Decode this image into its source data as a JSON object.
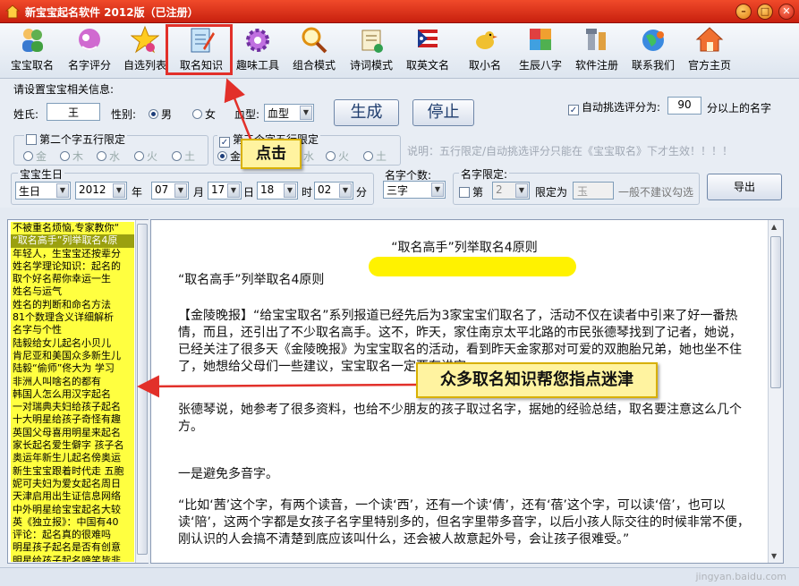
{
  "window": {
    "title": "新宝宝起名软件 2012版（已注册）",
    "min": "–",
    "max": "□",
    "close": "✕"
  },
  "toolbar": [
    {
      "label": "宝宝取名",
      "icon": "people-icon"
    },
    {
      "label": "名字评分",
      "icon": "score-icon"
    },
    {
      "label": "自选列表",
      "icon": "star-icon"
    },
    {
      "label": "取名知识",
      "icon": "notebook-pencil-icon"
    },
    {
      "label": "趣味工具",
      "icon": "gear-icon"
    },
    {
      "label": "组合模式",
      "icon": "magnifier-icon"
    },
    {
      "label": "诗词模式",
      "icon": "scroll-icon"
    },
    {
      "label": "取英文名",
      "icon": "flag-icon"
    },
    {
      "label": "取小名",
      "icon": "bird-icon"
    },
    {
      "label": "生辰八字",
      "icon": "blocks-icon"
    },
    {
      "label": "软件注册",
      "icon": "tools-icon"
    },
    {
      "label": "联系我们",
      "icon": "globe-icon"
    },
    {
      "label": "官方主页",
      "icon": "home-icon"
    }
  ],
  "settings": {
    "heading": "请设置宝宝相关信息:",
    "surname_label": "姓氏:",
    "surname_value": "王",
    "gender_label": "性别:",
    "gender_male": "男",
    "gender_female": "女",
    "blood_label": "血型:",
    "blood_value": "血型",
    "generate": "生成",
    "stop": "停止",
    "auto_label": "自动挑选评分为:",
    "auto_value": "90",
    "auto_suffix": "分以上的名字",
    "second_wx": "第二个字五行限定",
    "third_wx": "第三个字五行限定",
    "wx": [
      "金",
      "木",
      "水",
      "火",
      "土"
    ],
    "note": "说明：五行限定/自动挑选评分只能在《宝宝取名》下才生效！！！！",
    "birth_group": "宝宝生日",
    "birth_type": "生日",
    "year": "2012",
    "year_u": "年",
    "month": "07",
    "month_u": "月",
    "day": "17",
    "day_u": "日",
    "hour": "18",
    "hour_u": "时",
    "minute": "02",
    "minute_u": "分",
    "count_label": "名字个数:",
    "count_value": "三字",
    "limit_label": "名字限定:",
    "limit_di": "第",
    "limit_pos": "2",
    "limit_as": "限定为",
    "limit_char": "玉",
    "limit_hint": "一般不建议勾选",
    "export": "导出"
  },
  "list": [
    "不被重名烦恼,专家教你“",
    "“取名高手”列举取名4原",
    "年轻人，生宝宝还按辈分",
    "姓名学理论知识：起名的",
    "取个好名帮你幸运一生",
    "姓名与运气",
    "姓名的判断和命名方法",
    "81个数理含义详细解析",
    "名字与个性",
    "陆毅给女儿起名小贝儿",
    "肯尼亚和美国众多新生儿",
    "陆毅“偷师”佟大为 学习",
    "非洲人叫啥名的都有",
    "韩国人怎么用汉字起名",
    "一对瑞典夫妇给孩子起名",
    "十大明星给孩子奇怪有趣",
    "英国父母喜用明星来起名",
    "家长起名爱生僻字 孩子名",
    "奥运年新生儿起名傍奥运",
    "新生宝宝跟着时代走 五胞",
    "妮可夫妇为爱女起名周日",
    "天津启用出生证信息网络",
    "中外明星给宝宝起名大较",
    "英《独立报》：中国有40",
    "评论：起名真的很难吗",
    "明星孩子起名是否有创意",
    "明星给孩子起名啼笑皆非"
  ],
  "article": {
    "heading": "“取名高手”列举取名4原则",
    "title": "“取名高手”列举取名4原则",
    "p1": "【金陵晚报】“给宝宝取名”系列报道已经先后为3家宝宝们取名了，活动不仅在读者中引来了好一番热情，而且，还引出了不少取名高手。这不，昨天，家住南京太平北路的市民张德琴找到了记者，她说，已经关注了很多天《金陵晚报》为宝宝取名的活动，看到昨天金家那对可爱的双胞胎兄弟，她也坐不住了，她想给父母们一些建议，宝宝取名一定要有讲究。",
    "p2": "张德琴说，她参考了很多资料，也给不少朋友的孩子取过名字，据她的经验总结，取名要注意这么几个方。",
    "p3": "一是避免多音字。",
    "p4": "“比如‘茜’这个字，有两个读音，一个读‘西’，还有一个读‘倩’，还有‘蓓’这个字，可以读‘倍’，也可以读‘陪’，这两个字都是女孩子名字里特别多的，但名字里带多音字，以后小孩人际交往的时候非常不便，刚认识的人会搞不清楚到底应该叫什么，还会被人故意起外号，会让孩子很难受。”"
  },
  "callouts": {
    "click": "点击",
    "info": "众多取名知识帮您指点迷津"
  },
  "watermark": "jingyan.baidu.com"
}
